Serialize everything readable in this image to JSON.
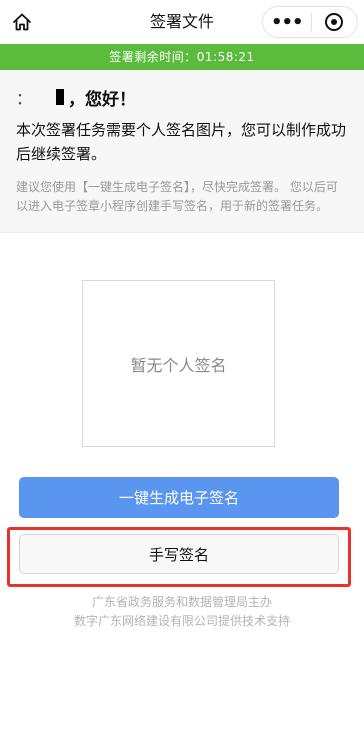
{
  "navbar": {
    "title": "签署文件",
    "home_icon": "home-icon",
    "more_icon": "more-dots-icon",
    "close_icon": "close-target-icon"
  },
  "countdown": {
    "text": "签署剩余时间：01:58:21",
    "color": "#5bbb3c"
  },
  "intro": {
    "name_mask": "：  ",
    "greeting": "，您好！",
    "main_text": "本次签署任务需要个人签名图片，您可以制作成功后继续签署。",
    "sub_text": "建议您使用【一键生成电子签名】，尽快完成签署。 您以后可以进入电子签章小程序创建手写签名，用于新的签署任务。"
  },
  "signature": {
    "empty_text": "暂无个人签名"
  },
  "buttons": {
    "generate_label": "一键生成电子签名",
    "handwrite_label": "手写签名",
    "primary_color": "#5a95f0",
    "highlight_color": "#e8322c"
  },
  "footer": {
    "line1": "广东省政务服务和数据管理局主办",
    "line2": "数字广东网络建设有限公司提供技术支持"
  }
}
